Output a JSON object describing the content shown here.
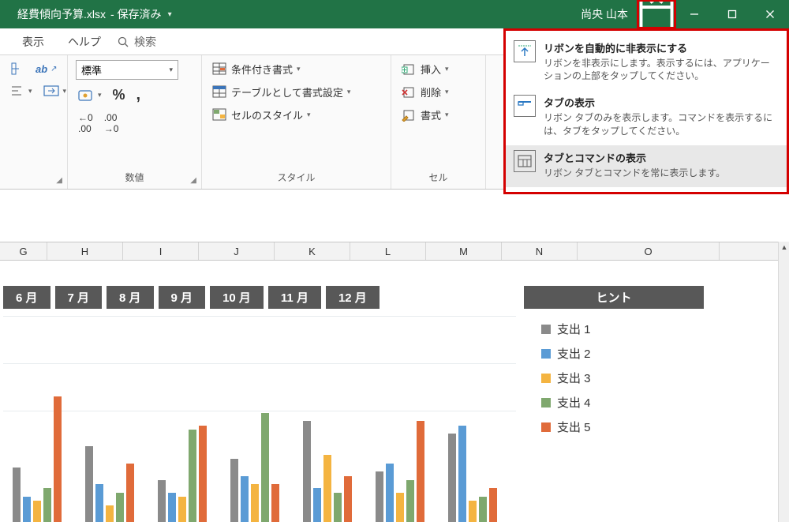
{
  "titlebar": {
    "filename": "経費傾向予算.xlsx",
    "saved_status": "- 保存済み",
    "user": "尚央 山本"
  },
  "ribbontabs": {
    "view": "表示",
    "help": "ヘルプ",
    "search": "検索"
  },
  "ribbon": {
    "number_format": "標準",
    "cond_fmt": "条件付き書式",
    "format_table": "テーブルとして書式設定",
    "cell_styles": "セルのスタイル",
    "insert": "挿入",
    "delete": "削除",
    "format": "書式",
    "group_number": "数値",
    "group_styles": "スタイル",
    "group_cells": "セル"
  },
  "ribbon_menu": {
    "opt1_t": "リボンを自動的に非表示にする",
    "opt1_d": "リボンを非表示にします。表示するには、アプリケーションの上部をタップしてください。",
    "opt2_t": "タブの表示",
    "opt2_d": "リボン タブのみを表示します。コマンドを表示するには、タブをタップしてください。",
    "opt3_t": "タブとコマンドの表示",
    "opt3_d": "リボン タブとコマンドを常に表示します。"
  },
  "columns": {
    "G": "G",
    "H": "H",
    "I": "I",
    "J": "J",
    "K": "K",
    "L": "L",
    "M": "M",
    "N": "N",
    "O": "O"
  },
  "chart": {
    "months": [
      "6 月",
      "7 月",
      "8 月",
      "9 月",
      "10 月",
      "11 月",
      "12 月"
    ],
    "hint": "ヒント",
    "legend": [
      "支出 1",
      "支出 2",
      "支出 3",
      "支出 4",
      "支出 5"
    ],
    "colors": [
      "#8a8a8a",
      "#5a9bd5",
      "#f4b441",
      "#7fa86e",
      "#e06b3a"
    ]
  },
  "chart_data": {
    "type": "bar",
    "categories": [
      "6 月",
      "7 月",
      "8 月",
      "9 月",
      "10 月",
      "11 月",
      "12 月"
    ],
    "series": [
      {
        "name": "支出 1",
        "values": [
          65,
          90,
          50,
          75,
          120,
          60,
          105
        ]
      },
      {
        "name": "支出 2",
        "values": [
          30,
          45,
          35,
          55,
          40,
          70,
          115
        ]
      },
      {
        "name": "支出 3",
        "values": [
          25,
          20,
          30,
          45,
          80,
          35,
          25
        ]
      },
      {
        "name": "支出 4",
        "values": [
          40,
          35,
          110,
          130,
          35,
          50,
          30
        ]
      },
      {
        "name": "支出 5",
        "values": [
          150,
          70,
          115,
          45,
          55,
          120,
          40
        ]
      }
    ],
    "title": "",
    "xlabel": "",
    "ylabel": "",
    "ylim": [
      0,
      160
    ]
  }
}
